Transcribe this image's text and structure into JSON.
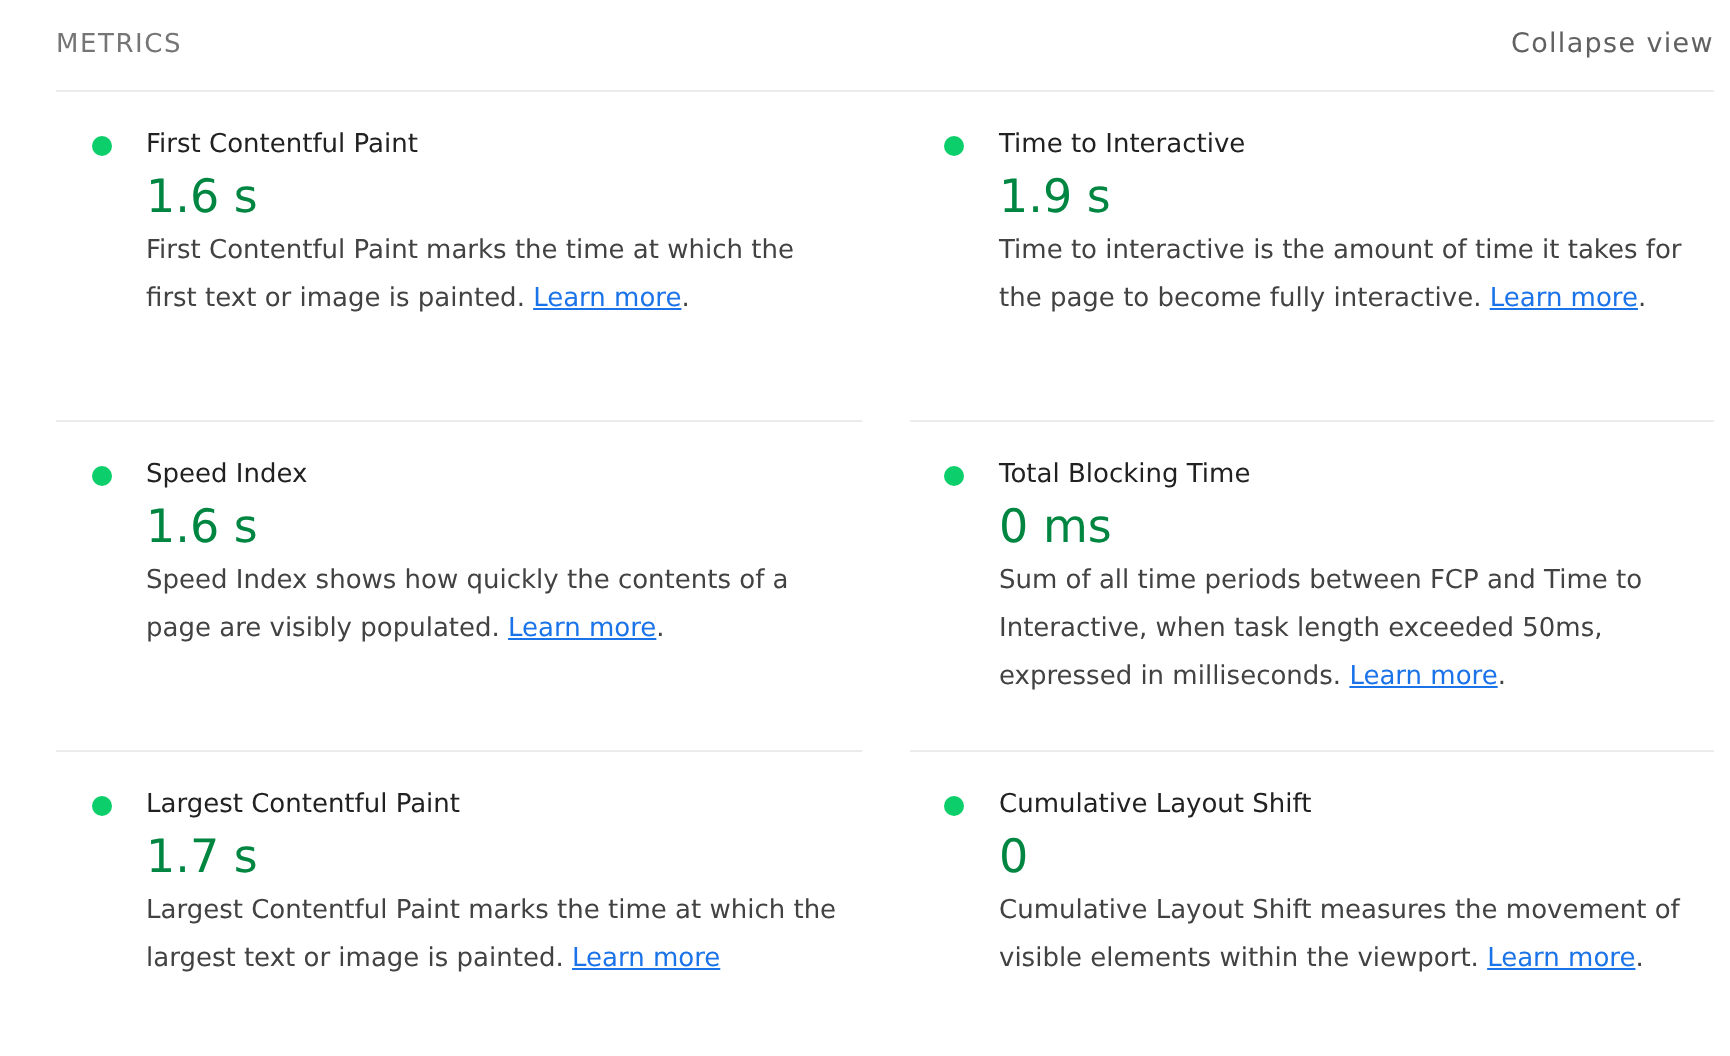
{
  "header": {
    "title": "METRICS",
    "toggle": "Collapse view"
  },
  "metrics": [
    {
      "title": "First Contentful Paint",
      "value": "1.6 s",
      "color": "#0cce6b",
      "description": "First Contentful Paint marks the time at which the first text or image is painted.",
      "link": "Learn more",
      "tail": "."
    },
    {
      "title": "Time to Interactive",
      "value": "1.9 s",
      "color": "#0cce6b",
      "description": "Time to interactive is the amount of time it takes for the page to become fully interactive.",
      "link": "Learn more",
      "tail": "."
    },
    {
      "title": "Speed Index",
      "value": "1.6 s",
      "color": "#0cce6b",
      "description": "Speed Index shows how quickly the contents of a page are visibly populated.",
      "link": "Learn more",
      "tail": "."
    },
    {
      "title": "Total Blocking Time",
      "value": "0 ms",
      "color": "#0cce6b",
      "description": "Sum of all time periods between FCP and Time to Interactive, when task length exceeded 50ms, expressed in milliseconds.",
      "link": "Learn more",
      "tail": "."
    },
    {
      "title": "Largest Contentful Paint",
      "value": "1.7 s",
      "color": "#0cce6b",
      "description": "Largest Contentful Paint marks the time at which the largest text or image is painted.",
      "link": "Learn more"
    },
    {
      "title": "Cumulative Layout Shift",
      "value": "0",
      "color": "#0cce6b",
      "description": "Cumulative Layout Shift measures the movement of visible elements within the viewport.",
      "link": "Learn more",
      "tail": "."
    }
  ]
}
